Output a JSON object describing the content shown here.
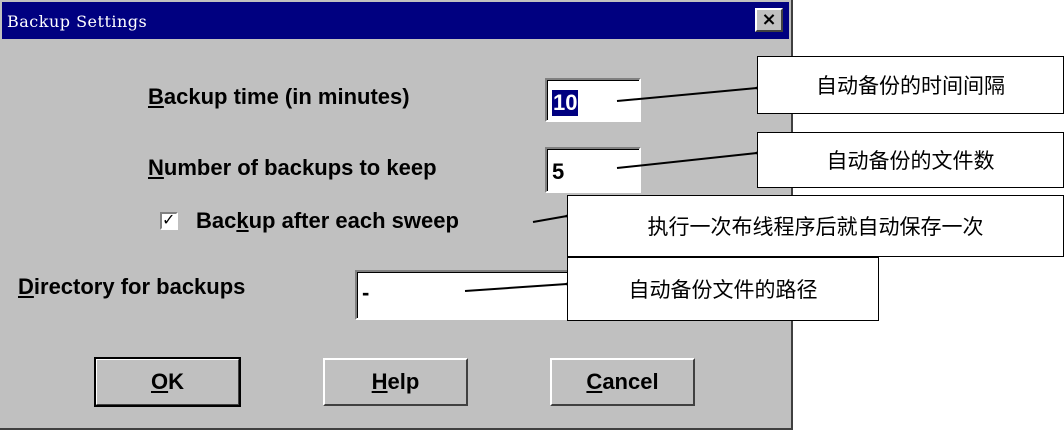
{
  "dialog": {
    "title": "Backup Settings",
    "close_label": "×",
    "backup_time": {
      "label_accel": "B",
      "label_rest": "ackup time (in minutes)",
      "value": "10"
    },
    "num_backups": {
      "label_accel": "N",
      "label_rest": "umber of backups to keep",
      "value": "5"
    },
    "after_sweep": {
      "checked": true,
      "check_glyph": "✓",
      "label_pre": "Bac",
      "label_accel": "k",
      "label_post": "up after each sweep"
    },
    "directory": {
      "label_accel": "D",
      "label_rest": "irectory for backups",
      "value": "-"
    },
    "buttons": {
      "ok": {
        "accel": "O",
        "rest": "K"
      },
      "help": {
        "accel": "H",
        "rest": "elp"
      },
      "cancel": {
        "accel": "C",
        "rest": "ancel"
      }
    }
  },
  "annotations": {
    "backup_time": "自动备份的时间间隔",
    "num_backups": "自动备份的文件数",
    "after_sweep": "执行一次布线程序后就自动保存一次",
    "directory": "自动备份文件的路径"
  }
}
